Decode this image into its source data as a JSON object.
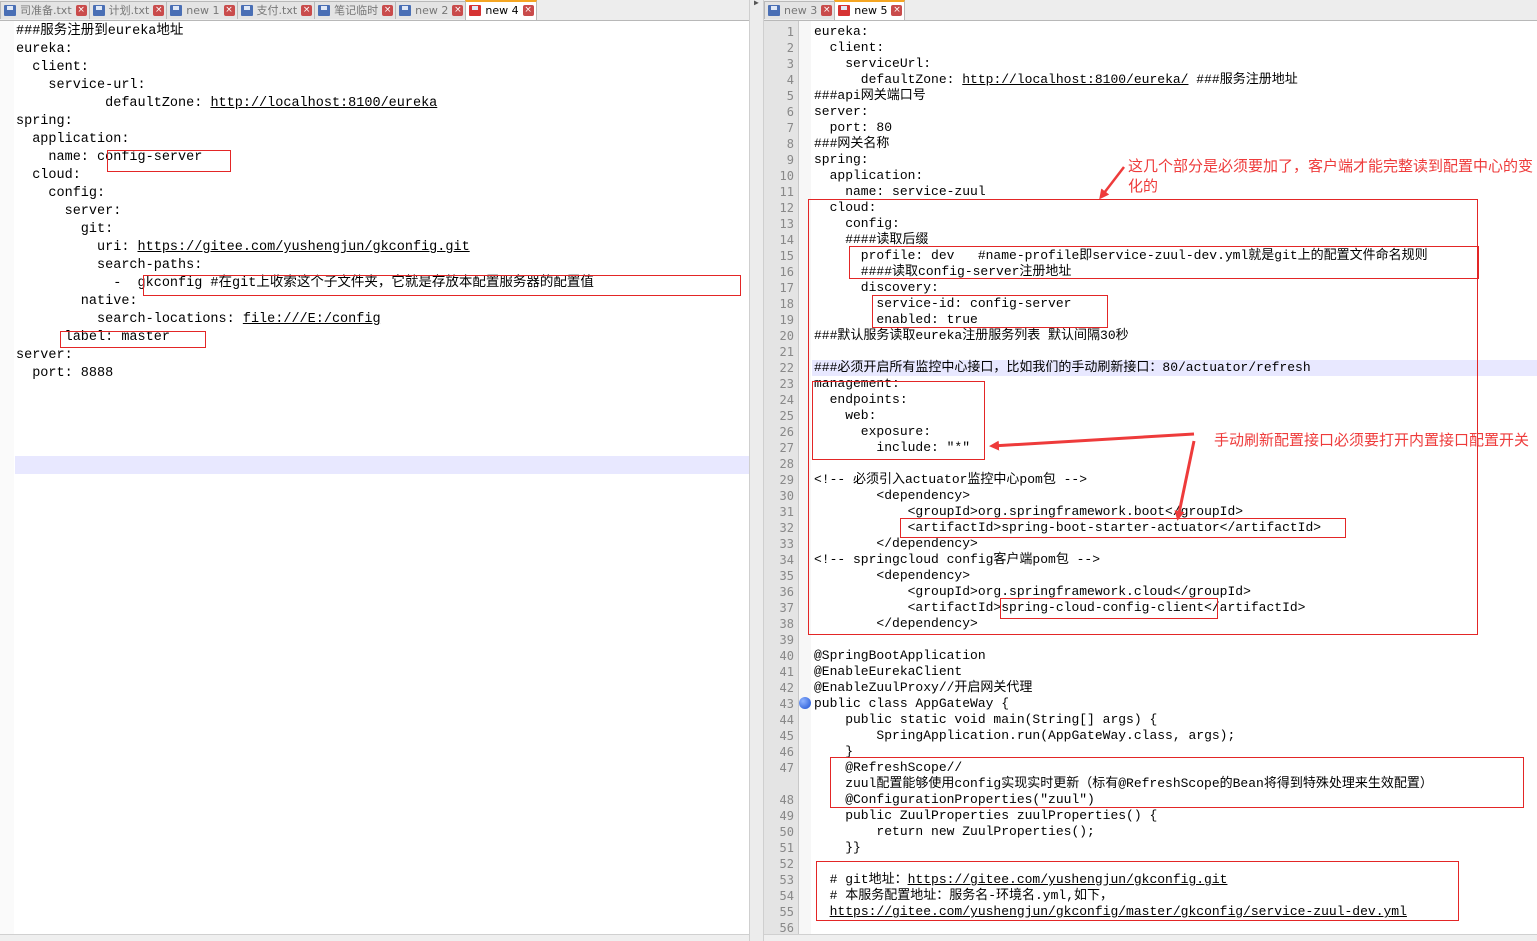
{
  "left_tabs": [
    {
      "label": "司准备.txt",
      "active": false
    },
    {
      "label": "计划.txt",
      "active": false
    },
    {
      "label": "new 1",
      "active": false
    },
    {
      "label": "支付.txt",
      "active": false
    },
    {
      "label": "笔记临时",
      "active": false
    },
    {
      "label": "new 2",
      "active": false
    },
    {
      "label": "new 4",
      "active": true
    }
  ],
  "right_tabs": [
    {
      "label": "new 3",
      "active": false
    },
    {
      "label": "new 5",
      "active": true
    }
  ],
  "left_editor_lines": [
    {
      "text": "###服务注册到eureka地址"
    },
    {
      "text": "eureka:"
    },
    {
      "text": "  client:"
    },
    {
      "text": "    service-url:"
    },
    {
      "text": "           defaultZone: ",
      "link": "http://localhost:8100/eureka"
    },
    {
      "text": "spring:"
    },
    {
      "text": "  application:"
    },
    {
      "text": "    name: config-server"
    },
    {
      "text": "  cloud:"
    },
    {
      "text": "    config:"
    },
    {
      "text": "      server:"
    },
    {
      "text": "        git:"
    },
    {
      "text": "          uri: ",
      "link": "https://gitee.com/yushengjun/gkconfig.git"
    },
    {
      "text": "          search-paths:"
    },
    {
      "text": "            -  gkconfig #在git上收索这个子文件夹，它就是存放本配置服务器的配置值"
    },
    {
      "text": "        native:"
    },
    {
      "text": "          search-locations: ",
      "link": "file:///E:/config"
    },
    {
      "text": "      label: master"
    },
    {
      "text": "server:"
    },
    {
      "text": "  port: 8888"
    }
  ],
  "right_editor_lines": [
    {
      "n": "1",
      "text": "eureka:"
    },
    {
      "n": "2",
      "text": "  client:"
    },
    {
      "n": "3",
      "text": "    serviceUrl:"
    },
    {
      "n": "4",
      "text": "      defaultZone: ",
      "link": "http://localhost:8100/eureka/",
      "after": " ###服务注册地址"
    },
    {
      "n": "5",
      "text": "###api网关端口号"
    },
    {
      "n": "6",
      "text": "server:"
    },
    {
      "n": "7",
      "text": "  port: 80"
    },
    {
      "n": "8",
      "text": "###网关名称"
    },
    {
      "n": "9",
      "text": "spring:"
    },
    {
      "n": "10",
      "text": "  application:"
    },
    {
      "n": "11",
      "text": "    name: service-zuul"
    },
    {
      "n": "12",
      "text": "  cloud:"
    },
    {
      "n": "13",
      "text": "    config:"
    },
    {
      "n": "14",
      "text": "    ####读取后缀"
    },
    {
      "n": "15",
      "text": "      profile: dev   #name-profile即service-zuul-dev.yml就是git上的配置文件命名规则"
    },
    {
      "n": "16",
      "text": "      ####读取config-server注册地址"
    },
    {
      "n": "17",
      "text": "      discovery:"
    },
    {
      "n": "18",
      "text": "        service-id: config-server"
    },
    {
      "n": "19",
      "text": "        enabled: true"
    },
    {
      "n": "20",
      "text": "###默认服务读取eureka注册服务列表 默认间隔30秒"
    },
    {
      "n": "21",
      "text": ""
    },
    {
      "n": "22",
      "text": "###必须开启所有监控中心接口，比如我们的手动刷新接口：80/actuator/refresh"
    },
    {
      "n": "23",
      "text": "management:"
    },
    {
      "n": "24",
      "text": "  endpoints:"
    },
    {
      "n": "25",
      "text": "    web:"
    },
    {
      "n": "26",
      "text": "      exposure:"
    },
    {
      "n": "27",
      "text": "        include: \"*\""
    },
    {
      "n": "28",
      "text": ""
    },
    {
      "n": "29",
      "text": "<!-- 必须引入actuator监控中心pom包 -->"
    },
    {
      "n": "30",
      "text": "        <dependency>"
    },
    {
      "n": "31",
      "text": "            <groupId>org.springframework.boot</groupId>"
    },
    {
      "n": "32",
      "text": "            <artifactId>spring-boot-starter-actuator</artifactId>"
    },
    {
      "n": "33",
      "text": "        </dependency>"
    },
    {
      "n": "34",
      "text": "<!-- springcloud config客户端pom包 -->"
    },
    {
      "n": "35",
      "text": "        <dependency>"
    },
    {
      "n": "36",
      "text": "            <groupId>org.springframework.cloud</groupId>"
    },
    {
      "n": "37",
      "text": "            <artifactId>spring-cloud-config-client</artifactId>"
    },
    {
      "n": "38",
      "text": "        </dependency>"
    },
    {
      "n": "39",
      "text": ""
    },
    {
      "n": "40",
      "text": "@SpringBootApplication"
    },
    {
      "n": "41",
      "text": "@EnableEurekaClient"
    },
    {
      "n": "42",
      "text": "@EnableZuulProxy//开启网关代理"
    },
    {
      "n": "43",
      "text": "public class AppGateWay {"
    },
    {
      "n": "44",
      "text": "    public static void main(String[] args) {"
    },
    {
      "n": "45",
      "text": "        SpringApplication.run(AppGateWay.class, args);"
    },
    {
      "n": "46",
      "text": "    }"
    },
    {
      "n": "47",
      "text": "    @RefreshScope//"
    },
    {
      "n": "",
      "text": "    zuul配置能够使用config实现实时更新（标有@RefreshScope的Bean将得到特殊处理来生效配置）"
    },
    {
      "n": "48",
      "text": "    @ConfigurationProperties(\"zuul\")"
    },
    {
      "n": "49",
      "text": "    public ZuulProperties zuulProperties() {"
    },
    {
      "n": "50",
      "text": "        return new ZuulProperties();"
    },
    {
      "n": "51",
      "text": "    }}"
    },
    {
      "n": "52",
      "text": ""
    },
    {
      "n": "53",
      "text": "  # git地址：",
      "link": "https://gitee.com/yushengjun/gkconfig.git"
    },
    {
      "n": "54",
      "text": "  # 本服务配置地址：服务名-环境名.yml,如下，"
    },
    {
      "n": "55",
      "text": "  ",
      "link": "https://gitee.com/yushengjun/gkconfig/master/gkconfig/service-zuul-dev.yml"
    },
    {
      "n": "56",
      "text": ""
    }
  ],
  "annotations": {
    "note_required": "这几个部分是必须要加了，客户端才能完整读到配置中心的变化的",
    "note_refresh": "手动刷新配置接口必须要打开内置接口配置开关"
  },
  "colors": {
    "annotation_red": "#e32626",
    "line_highlight": "#e8e8ff",
    "active_tab_accent": "#f5a623"
  }
}
